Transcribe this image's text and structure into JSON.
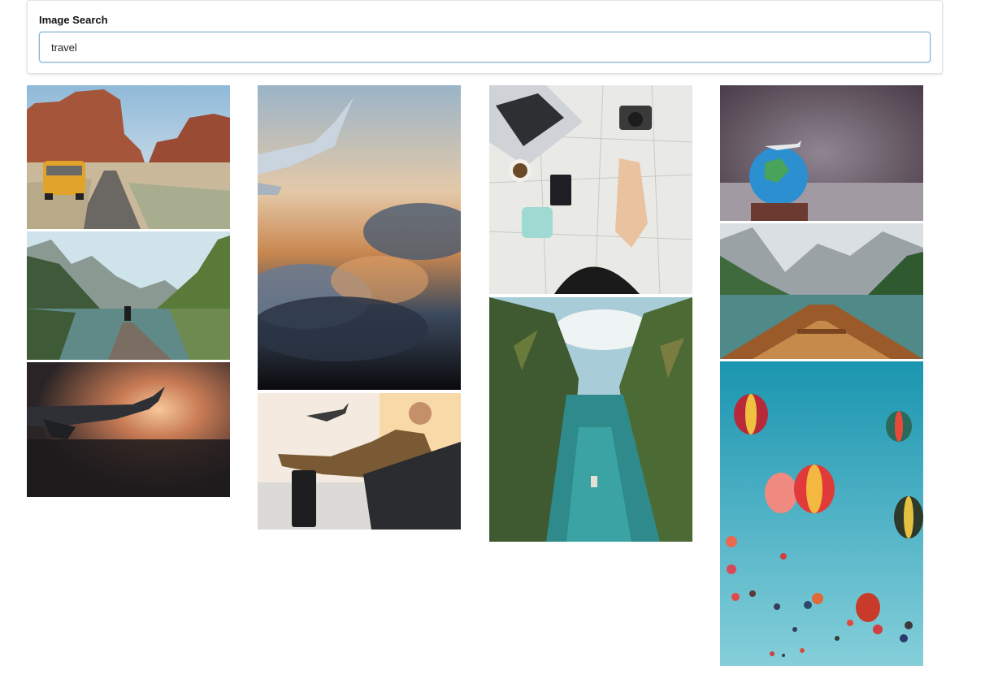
{
  "search": {
    "label": "Image Search",
    "value": "travel"
  },
  "gallery": {
    "columns": [
      {
        "tiles": [
          {
            "name": "image-desert-van"
          },
          {
            "name": "image-lake-pier"
          },
          {
            "name": "image-plane-wing-sunset"
          }
        ]
      },
      {
        "tiles": [
          {
            "name": "image-plane-wing-clouds"
          },
          {
            "name": "image-airport-traveler"
          }
        ]
      },
      {
        "tiles": [
          {
            "name": "image-map-flatlay"
          },
          {
            "name": "image-tropical-river"
          }
        ]
      },
      {
        "tiles": [
          {
            "name": "image-globe-toy-plane"
          },
          {
            "name": "image-mountain-lake-boat"
          },
          {
            "name": "image-hot-air-balloons"
          }
        ]
      }
    ]
  }
}
